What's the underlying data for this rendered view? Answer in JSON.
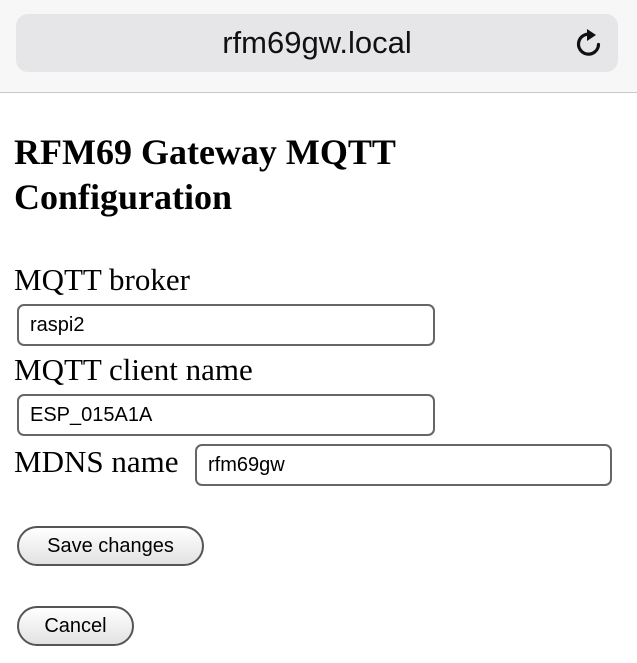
{
  "browser": {
    "url": "rfm69gw.local",
    "reload_icon": "reload-icon"
  },
  "page": {
    "title": "RFM69 Gateway MQTT Configuration",
    "fields": {
      "mqtt_broker": {
        "label": "MQTT broker",
        "value": "raspi2"
      },
      "mqtt_client_name": {
        "label": "MQTT client name",
        "value": "ESP_015A1A"
      },
      "mdns_name": {
        "label": "MDNS name",
        "value": "rfm69gw"
      }
    },
    "buttons": {
      "save_label": "Save changes",
      "cancel_label": "Cancel"
    }
  }
}
